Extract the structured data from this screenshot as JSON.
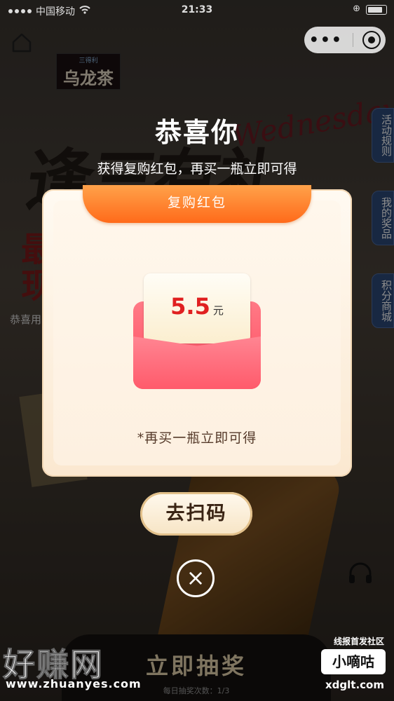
{
  "status_bar": {
    "carrier": "中国移动",
    "time": "21:33"
  },
  "brand": {
    "top": "三得利",
    "main": "乌龙茶"
  },
  "background": {
    "script": "Wednesday",
    "congrats_prefix": "恭喜用"
  },
  "side_tabs": [
    {
      "label": "活动规则"
    },
    {
      "label": "我的奖品"
    },
    {
      "label": "积分商城"
    }
  ],
  "popup": {
    "headline": "恭喜你",
    "subline": "获得复购红包，再买一瓶立即可得",
    "ribbon": "复购红包",
    "amount": "5.5",
    "unit": "元",
    "note": "*再买一瓶立即可得",
    "scan_button": "去扫码",
    "close_symbol": "×"
  },
  "bottom": {
    "draw_text": "立即抽奖",
    "daily_text": "每日抽奖次数：1/3"
  },
  "watermarks": {
    "left_main": "好赚网",
    "left_url": "www.zhuanyes.com",
    "right_top": "线报首发社区",
    "right_box": "小嘀咕",
    "right_url": "xdglt.com"
  }
}
